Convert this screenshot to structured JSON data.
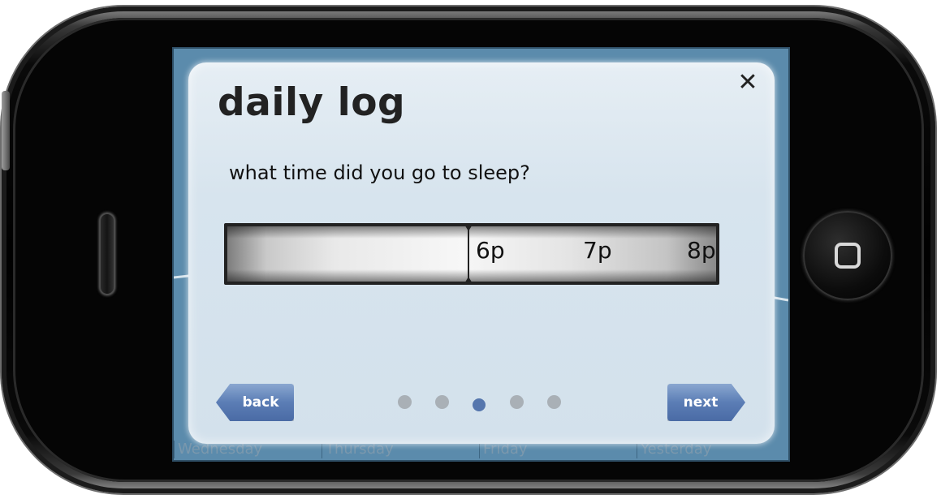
{
  "dialog": {
    "title": "daily log",
    "close_symbol": "✕",
    "question": "what time did you go to sleep?"
  },
  "time_picker": {
    "ticks": [
      "6p",
      "7p",
      "8p"
    ]
  },
  "pager": {
    "total": 5,
    "current": 3
  },
  "buttons": {
    "back_label": "back",
    "next_label": "next"
  },
  "background_days": [
    "Wednesday",
    "Thursday",
    "Friday",
    "Yesterday"
  ],
  "colors": {
    "accent": "#5576ad",
    "dialog_bg": "#d7e4ee",
    "screen_bg": "#5b8bac"
  },
  "icons": {
    "close": "close-icon",
    "home": "home-button-icon"
  }
}
